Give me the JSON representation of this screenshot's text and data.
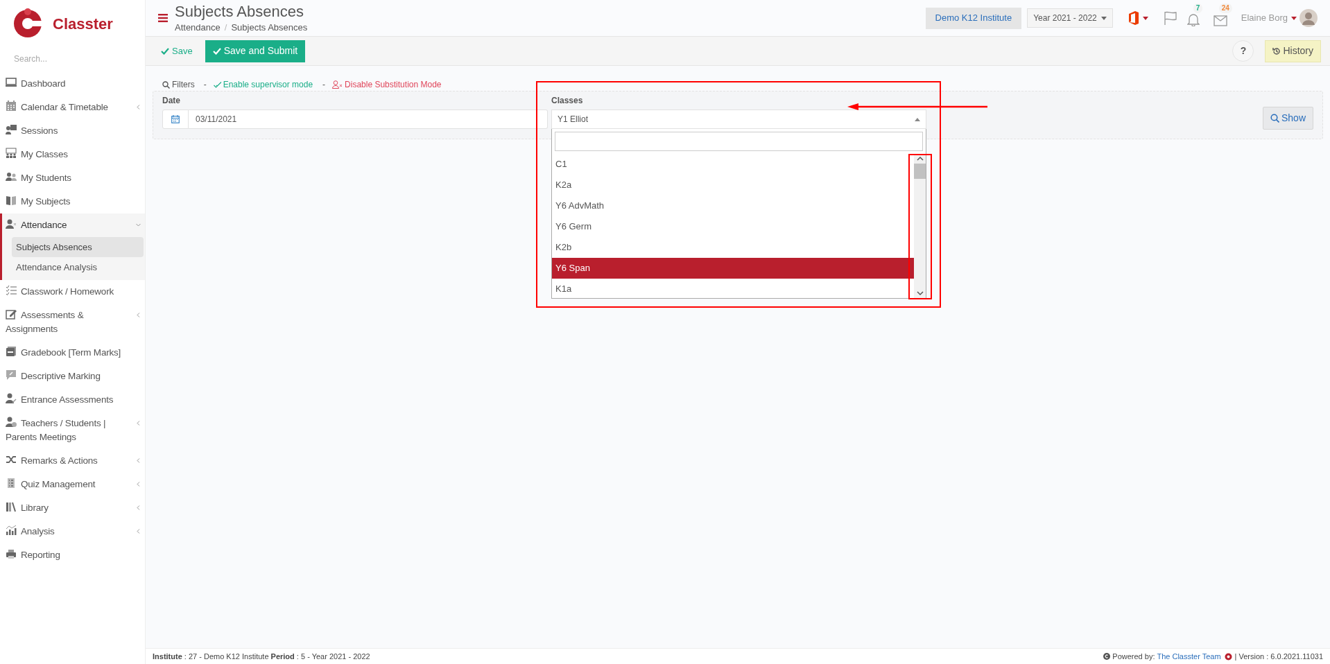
{
  "app": {
    "logo_text": "Classter"
  },
  "sidebar": {
    "search_placeholder": "Search...",
    "items": [
      {
        "label": "Dashboard",
        "selected": false
      },
      {
        "label": "Calendar & Timetable",
        "selected": false,
        "expanded": false
      },
      {
        "label": "Sessions",
        "selected": false
      },
      {
        "label": "My Classes",
        "selected": false
      },
      {
        "label": "My Students",
        "selected": false
      },
      {
        "label": "My Subjects",
        "selected": false
      },
      {
        "label": "Attendance",
        "selected": true,
        "expanded": true,
        "children": [
          {
            "label": "Subjects Absences",
            "selected": true
          },
          {
            "label": "Attendance Analysis",
            "selected": false
          }
        ]
      },
      {
        "label": "Classwork / Homework",
        "selected": false
      },
      {
        "label": "Assessments & Assignments",
        "selected": false,
        "expanded": false
      },
      {
        "label": "Gradebook [Term Marks]",
        "selected": false
      },
      {
        "label": "Descriptive Marking",
        "selected": false
      },
      {
        "label": "Entrance Assessments",
        "selected": false
      },
      {
        "label": "Teachers / Students | Parents Meetings",
        "selected": false,
        "expanded": false
      },
      {
        "label": "Remarks & Actions",
        "selected": false,
        "expanded": false
      },
      {
        "label": "Quiz Management",
        "selected": false,
        "expanded": false
      },
      {
        "label": "Library",
        "selected": false,
        "expanded": false
      },
      {
        "label": "Analysis",
        "selected": false,
        "expanded": false
      },
      {
        "label": "Reporting",
        "selected": false
      }
    ]
  },
  "header": {
    "title": "Subjects Absences",
    "breadcrumb": [
      "Attendance",
      "Subjects Absences"
    ],
    "breadcrumb_separator": "/",
    "institute": "Demo K12 Institute",
    "year": "Year 2021 - 2022",
    "notifications_count": "7",
    "messages_count": "24",
    "user": "Elaine Borg"
  },
  "toolbar": {
    "save": "Save",
    "save_submit": "Save and Submit",
    "help": "?",
    "history": "History"
  },
  "filters": {
    "label": "Filters",
    "separator_1": "-",
    "supervisor": "Enable supervisor mode",
    "separator_2": "-",
    "substitution": "Disable Substitution Mode"
  },
  "form": {
    "date_label": "Date",
    "date_value": "03/11/2021",
    "classes_label": "Classes",
    "classes_value": "Y1 Elliot",
    "classes_open": true,
    "options": [
      {
        "label": "C1",
        "selected": false
      },
      {
        "label": "K2a",
        "selected": false
      },
      {
        "label": "Y6 AdvMath",
        "selected": false
      },
      {
        "label": "Y6 Germ",
        "selected": false
      },
      {
        "label": "K2b",
        "selected": false
      },
      {
        "label": "Y6 Span",
        "selected": true
      },
      {
        "label": "K1a",
        "selected": false
      }
    ],
    "show": "Show"
  },
  "footer": {
    "info": "**Institute** : 27 - Demo K12 Institute **Period** : 5 - Year 2021 - 2022",
    "powered_by": "Powered by:",
    "team": "The Classter Team",
    "version": "| Version : 6.0.2021.11031"
  }
}
